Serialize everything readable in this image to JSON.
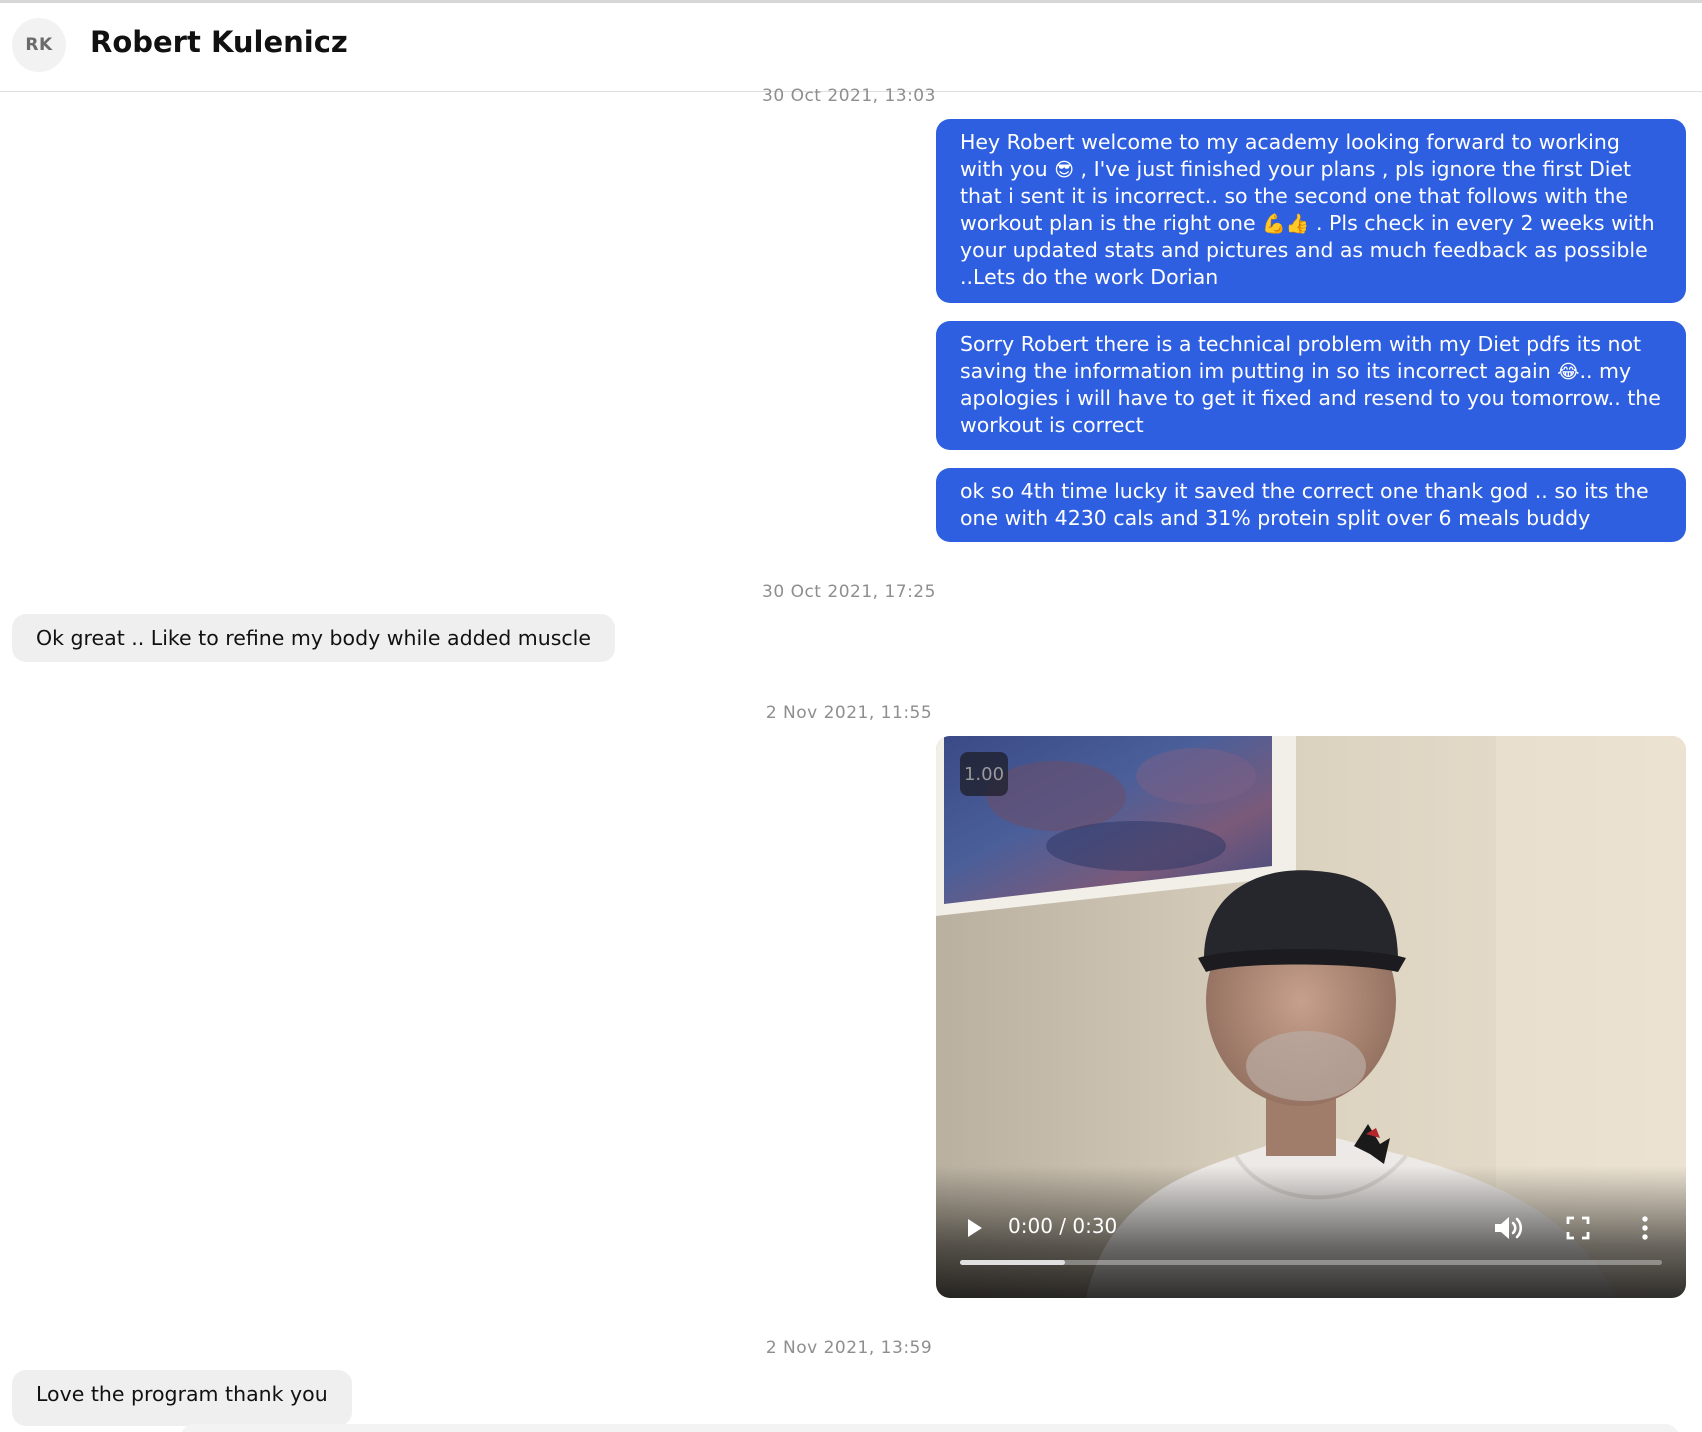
{
  "header": {
    "avatar_initials": "RK",
    "contact_name": "Robert Kulenicz"
  },
  "messages": [
    {
      "timestamp": "30 Oct 2021, 13:03",
      "outgoing": [
        {
          "segments": [
            "Hey Robert welcome to my academy looking forward to working with you ",
            " , I've just finished your plans , pls ignore the first Diet that i sent it is incorrect.. so the second one that follows with the workout plan is the right one ",
            " . Pls check in every 2 weeks with your updated stats and pictures and  as much feedback as possible ..Lets do the work Dorian"
          ],
          "emojis": [
            "😎",
            "💪👍"
          ]
        },
        {
          "segments": [
            "Sorry Robert there is a technical problem with my Diet pdfs its not saving the information im putting in so its incorrect again ",
            ".. my apologies i will have to get it fixed and resend to you tomorrow.. the workout is correct"
          ],
          "emojis": [
            "😂"
          ]
        },
        {
          "segments": [
            "ok so 4th time lucky it saved the correct one thank god .. so its the one with 4230 cals and 31% protein split over 6 meals buddy"
          ],
          "emojis": []
        }
      ]
    },
    {
      "timestamp": "30 Oct 2021, 17:25",
      "incoming": "Ok great .. Like to refine my body while added muscle"
    },
    {
      "timestamp": "2 Nov 2021, 11:55",
      "video": {
        "speed": "1.00",
        "time": "0:00 / 0:30",
        "buffered_fraction": 0.15,
        "icons": [
          "play-icon",
          "volume-icon",
          "fullscreen-icon",
          "more-vert-icon"
        ]
      }
    },
    {
      "timestamp": "2 Nov 2021, 13:59",
      "incoming": "Love the program thank you"
    }
  ],
  "colors": {
    "outgoing_bubble": "#2f5fe1",
    "incoming_bubble": "#efefef",
    "timestamp_text": "#8e8e8e"
  }
}
